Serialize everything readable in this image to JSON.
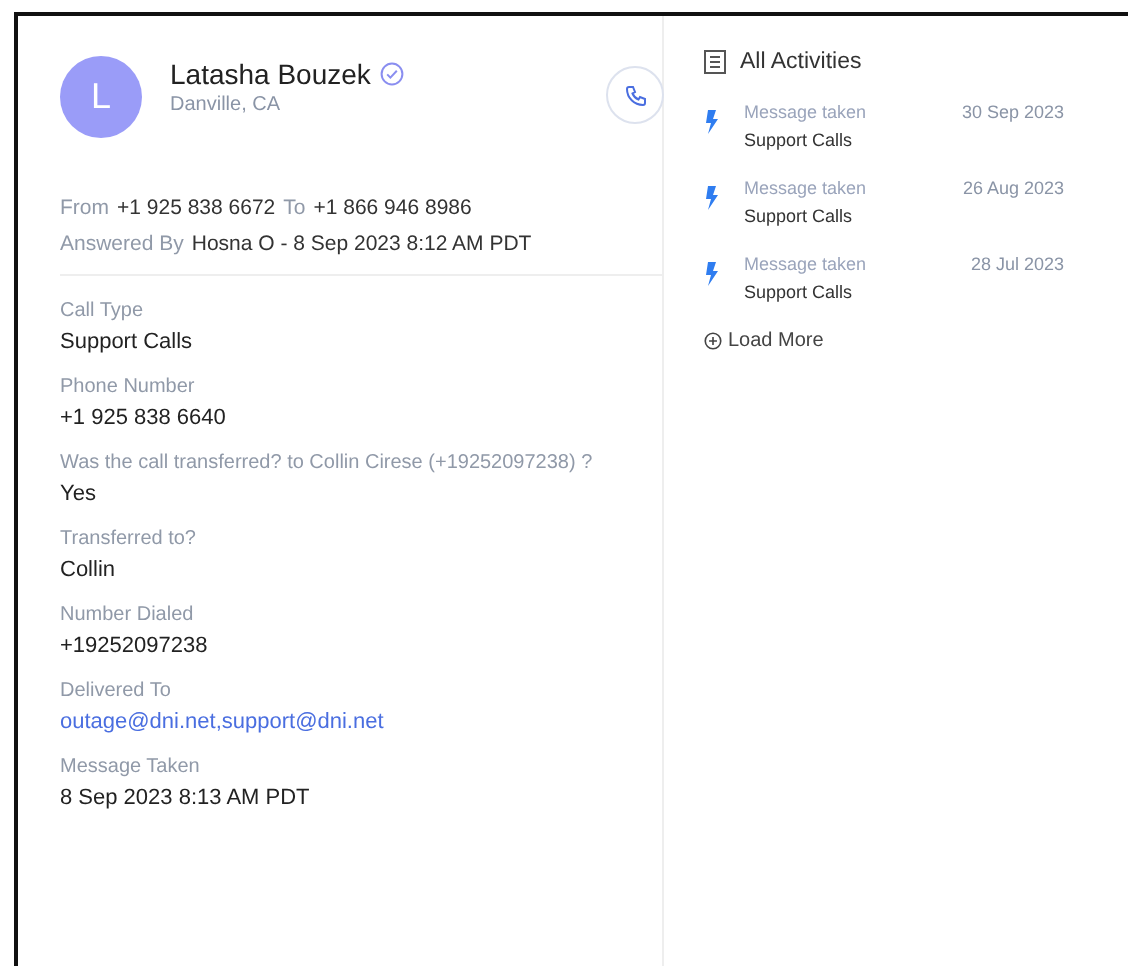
{
  "contact": {
    "initial": "L",
    "name": "Latasha Bouzek",
    "verified": true,
    "location": "Danville, CA"
  },
  "call_info": [
    {
      "label": "From",
      "value": "+1 925 838 6672"
    },
    {
      "label": "To",
      "value": "+1 866 946 8986"
    }
  ],
  "answered": {
    "label": "Answered By",
    "value": "Hosna O - 8 Sep 2023 8:12 AM PDT"
  },
  "fields": [
    {
      "label": "Call Type",
      "value": "Support Calls",
      "kind": "text"
    },
    {
      "label": "Phone Number",
      "value": "+1 925 838 6640",
      "kind": "text"
    },
    {
      "label": "Was the call transferred? to Collin Cirese (+19252097238) ?",
      "value": "Yes",
      "kind": "text"
    },
    {
      "label": "Transferred to?",
      "value": "Collin",
      "kind": "text"
    },
    {
      "label": "Number Dialed",
      "value": "+19252097238",
      "kind": "text"
    },
    {
      "label": "Delivered To",
      "value": "outage@dni.net,support@dni.net",
      "kind": "link"
    },
    {
      "label": "Message Taken",
      "value": "8 Sep 2023 8:13 AM PDT",
      "kind": "text"
    }
  ],
  "activities": {
    "title": "All Activities",
    "items": [
      {
        "action": "Message taken",
        "type": "Support Calls",
        "date": "30 Sep 2023"
      },
      {
        "action": "Message taken",
        "type": "Support Calls",
        "date": "26 Aug 2023"
      },
      {
        "action": "Message taken",
        "type": "Support Calls",
        "date": "28 Jul 2023"
      }
    ],
    "load_more": "Load More"
  }
}
